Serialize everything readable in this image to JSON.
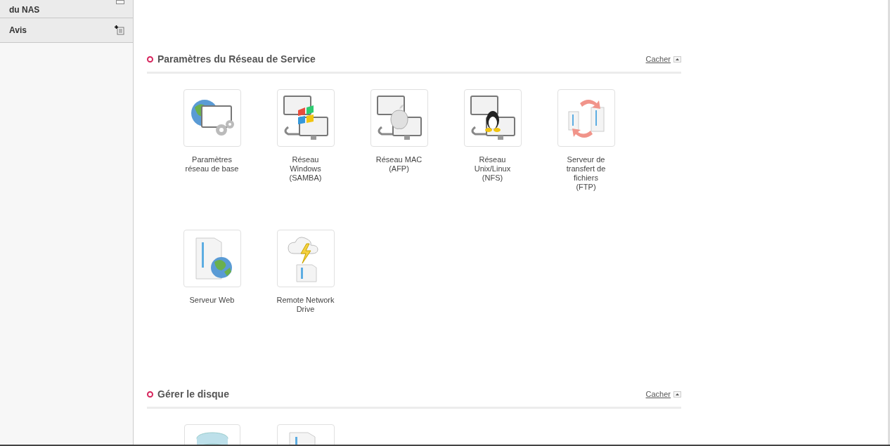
{
  "sidebar": {
    "items": [
      {
        "label": "du NAS",
        "kind": "minus"
      },
      {
        "label": "Avis",
        "kind": "add-list"
      }
    ]
  },
  "sections": [
    {
      "title": "Paramètres du Réseau de Service",
      "toggle": "Cacher",
      "items": [
        {
          "kind": "network",
          "label": "Paramètres\nréseau de base"
        },
        {
          "kind": "windows",
          "label": "Réseau\nWindows\n(SAMBA)"
        },
        {
          "kind": "mac",
          "label": "Réseau MAC\n(AFP)"
        },
        {
          "kind": "linux",
          "label": "Réseau\nUnix/Linux\n(NFS)"
        },
        {
          "kind": "ftp",
          "label": "Serveur de\ntransfert de\nfichiers\n(FTP)"
        },
        {
          "kind": "web",
          "label": "Serveur Web"
        },
        {
          "kind": "cloud",
          "label": "Remote Network\nDrive"
        }
      ]
    },
    {
      "title": "Gérer le disque",
      "toggle": "Cacher",
      "items": [
        {
          "kind": "disk"
        },
        {
          "kind": "server"
        }
      ]
    }
  ]
}
